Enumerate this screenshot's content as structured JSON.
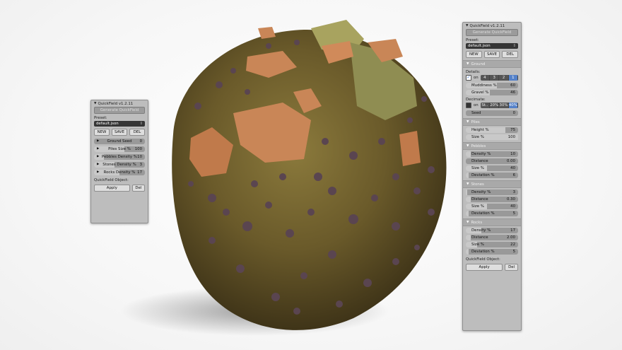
{
  "colors": {
    "panel_bg": "#bdbdbd",
    "accent_blue": "#5481c9",
    "input_dark": "#353535"
  },
  "left_panel": {
    "title": "QuickField v1.2.11",
    "generate_label": "Generate QuickField",
    "preset_label": "Preset:",
    "preset_value": "default.json",
    "btn_new": "NEW",
    "btn_save": "SAVE",
    "btn_del": "DEL",
    "rows": [
      {
        "label": "Ground Seed",
        "value": "0",
        "fill": 0
      },
      {
        "label": "Piles Size %",
        "value": "100",
        "fill": 0.6
      },
      {
        "label": "Pebbles Density %",
        "value": "10",
        "fill": 0.2
      },
      {
        "label": "Stones Density %",
        "value": "3",
        "fill": 0.4
      },
      {
        "label": "Rocks Density %",
        "value": "17",
        "fill": 0.5
      }
    ],
    "object_label": "QuickField Object:",
    "apply_label": "Apply",
    "del_label": "Del"
  },
  "right_panel": {
    "title": "QuickField v1.2.11",
    "generate_label": "Generate QuickField",
    "preset_label": "Preset:",
    "preset_value": "default.json",
    "btn_new": "NEW",
    "btn_save": "SAVE",
    "btn_del": "DEL",
    "ground": {
      "header": "Ground",
      "details_label": "Details:",
      "on_label": "on",
      "details_options": [
        "4",
        "3",
        "2",
        "1"
      ],
      "muddiness": {
        "label": "Muddiness %",
        "value": "60",
        "fill": 0.6
      },
      "gravel": {
        "label": "Gravel %",
        "value": "46",
        "fill": 0.46
      },
      "decimate_label": "Decimate:",
      "decimate_options": [
        "St..",
        "20%",
        "30%",
        "40%"
      ],
      "seed": {
        "label": "Seed",
        "value": "0"
      }
    },
    "piles": {
      "header": "Piles",
      "rows": [
        {
          "label": "Height %",
          "value": "75",
          "fill": 0.75
        },
        {
          "label": "Size %",
          "value": "100",
          "fill": 1.0
        }
      ]
    },
    "pebbles": {
      "header": "Pebbles",
      "rows": [
        {
          "label": "Density %",
          "value": "10",
          "fill": 0.1
        },
        {
          "label": "Distance",
          "value": "0.00",
          "fill": 0
        },
        {
          "label": "Size %",
          "value": "40",
          "fill": 0.4
        },
        {
          "label": "Deviation %",
          "value": "6",
          "fill": 0.06
        }
      ]
    },
    "stones": {
      "header": "Stones",
      "rows": [
        {
          "label": "Density %",
          "value": "3",
          "fill": 0.03
        },
        {
          "label": "Distance",
          "value": "0.30",
          "fill": 0.1
        },
        {
          "label": "Size %",
          "value": "40",
          "fill": 0.4
        },
        {
          "label": "Deviation %",
          "value": "5",
          "fill": 0.05
        }
      ]
    },
    "rocks": {
      "header": "Rocks",
      "rows": [
        {
          "label": "Density %",
          "value": "17",
          "fill": 0.3
        },
        {
          "label": "Distance",
          "value": "2.00",
          "fill": 0.1
        },
        {
          "label": "Size %",
          "value": "22",
          "fill": 0.22
        },
        {
          "label": "Deviation %",
          "value": "5",
          "fill": 0.05
        }
      ]
    },
    "object_label": "QuickField Object:",
    "apply_label": "Apply",
    "del_label": "Del"
  }
}
